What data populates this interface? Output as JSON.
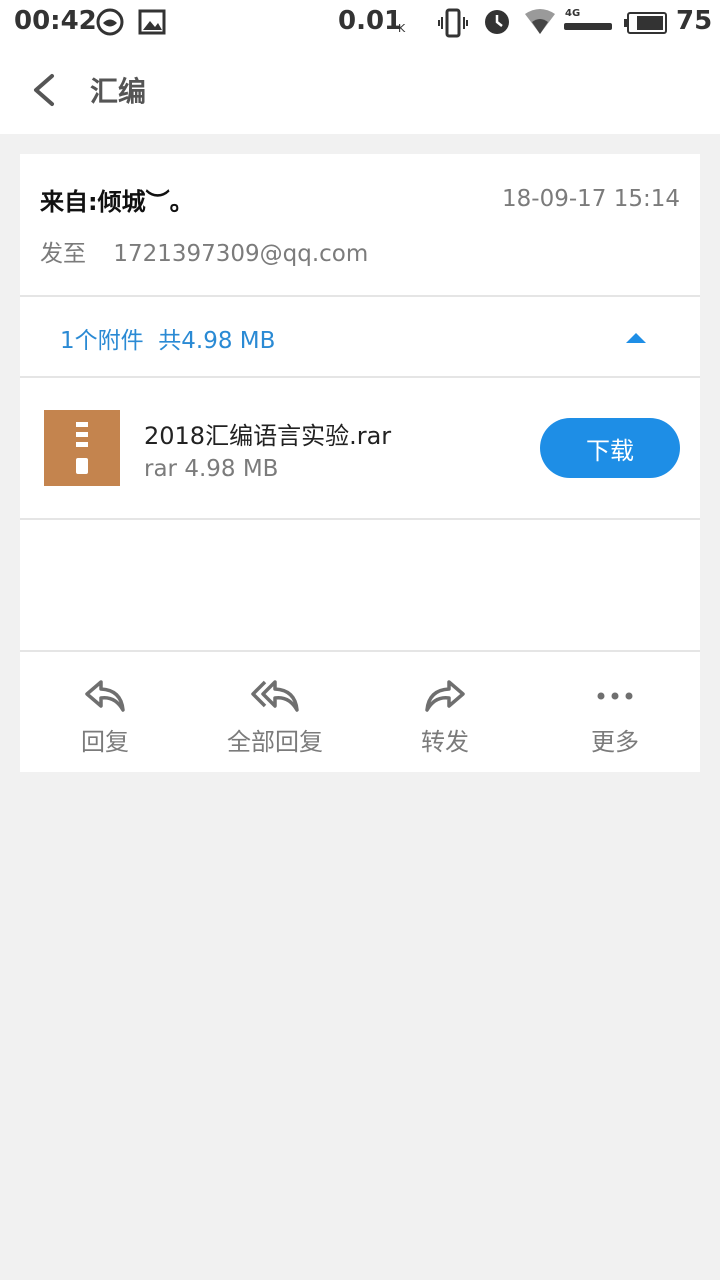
{
  "status_bar": {
    "time": "00:42",
    "speed": "0.01",
    "speed_unit": "K",
    "network": "4G",
    "battery": "75",
    "icons": [
      "moto-icon",
      "image-icon",
      "vibrate-icon",
      "alarm-icon",
      "wifi-icon",
      "signal-icon",
      "battery-icon"
    ]
  },
  "app_bar": {
    "title": "汇编"
  },
  "mail": {
    "from": "来自:倾城︶。",
    "date": "18-09-17 15:14",
    "to_label": "发至",
    "to_address": "1721397309@qq.com"
  },
  "attachments": {
    "summary": "1个附件  共4.98 MB",
    "files": [
      {
        "name": "2018汇编语言实验.rar",
        "meta": "rar 4.98 MB",
        "download_label": "下载"
      }
    ]
  },
  "actions": [
    {
      "label": "回复",
      "icon": "reply-icon"
    },
    {
      "label": "全部回复",
      "icon": "reply-all-icon"
    },
    {
      "label": "转发",
      "icon": "forward-icon"
    },
    {
      "label": "更多",
      "icon": "more-icon"
    }
  ],
  "colors": {
    "accent": "#2a8ad4",
    "download_button": "#1e8ee6",
    "archive_icon": "#c4844e"
  }
}
